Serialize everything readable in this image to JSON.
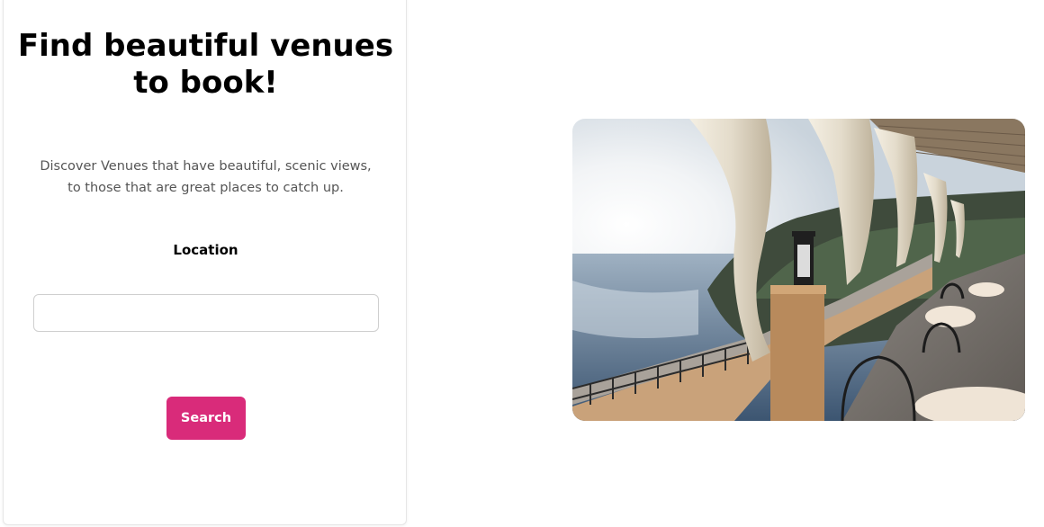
{
  "hero": {
    "title": "Find beautiful venues to book!",
    "description": "Discover Venues that have beautiful, scenic views, to those that are great places to catch up."
  },
  "search": {
    "location_label": "Location",
    "location_value": "",
    "location_placeholder": "",
    "button_label": "Search"
  },
  "image": {
    "alt": "Terrace restaurant overlooking the sea"
  },
  "colors": {
    "accent": "#d92b7a"
  }
}
